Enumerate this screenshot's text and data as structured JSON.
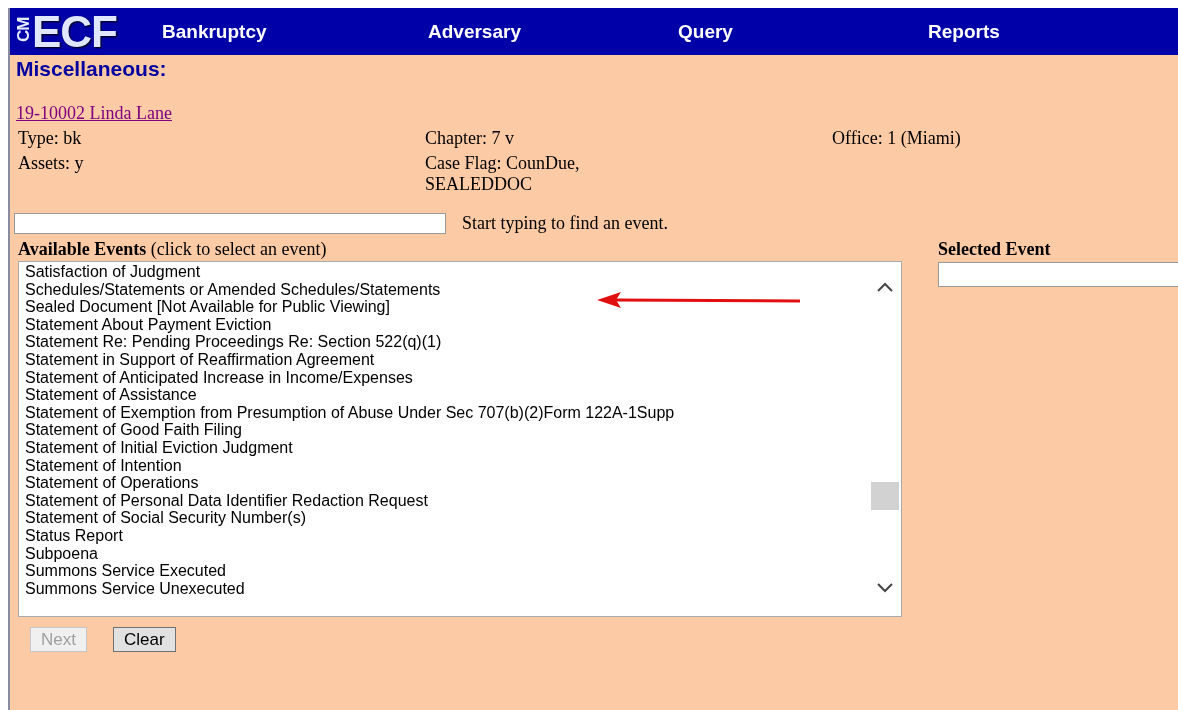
{
  "header": {
    "logo_small": "CM",
    "logo_large": "ECF",
    "nav": [
      "Bankruptcy",
      "Adversary",
      "Query",
      "Reports"
    ]
  },
  "page_title": "Miscellaneous:",
  "case_link": "19-10002 Linda Lane",
  "case_info": [
    [
      "Type: bk",
      "Chapter: 7 v",
      "Office: 1 (Miami)"
    ],
    [
      "Assets: y",
      "Case Flag: CounDue,\nSEALEDDOC"
    ]
  ],
  "search": {
    "hint": "Start typing to find an event."
  },
  "available": {
    "label": "Available Events",
    "note": "(click to select an event)",
    "items": [
      {
        "text": "Satisfaction of Judgment",
        "highlighted": false
      },
      {
        "text": "Schedules/Statements or Amended Schedules/Statements",
        "highlighted": false
      },
      {
        "text": "Sealed Document [Not Available for Public Viewing]",
        "highlighted": true
      },
      {
        "text": "Statement About Payment Eviction",
        "highlighted": false
      },
      {
        "text": "Statement Re: Pending Proceedings Re: Section 522(q)(1)",
        "highlighted": false
      },
      {
        "text": "Statement in Support of Reaffirmation Agreement",
        "highlighted": false
      },
      {
        "text": "Statement of Anticipated Increase in Income/Expenses",
        "highlighted": false
      },
      {
        "text": "Statement of Assistance",
        "highlighted": false
      },
      {
        "text": "Statement of Exemption from Presumption of Abuse Under Sec 707(b)(2)Form 122A-1Supp",
        "highlighted": false
      },
      {
        "text": "Statement of Good Faith Filing",
        "highlighted": false
      },
      {
        "text": "Statement of Initial Eviction Judgment",
        "highlighted": false
      },
      {
        "text": "Statement of Intention",
        "highlighted": false
      },
      {
        "text": "Statement of Operations",
        "highlighted": false
      },
      {
        "text": "Statement of Personal Data Identifier Redaction Request",
        "highlighted": false
      },
      {
        "text": "Statement of Social Security Number(s)",
        "highlighted": false
      },
      {
        "text": "Status Report",
        "highlighted": false
      },
      {
        "text": "Subpoena",
        "highlighted": false
      },
      {
        "text": "Summons Service Executed",
        "highlighted": false
      },
      {
        "text": "Summons Service Unexecuted",
        "highlighted": false
      }
    ]
  },
  "selected_event": {
    "label": "Selected Event"
  },
  "buttons": [
    {
      "label": "Next",
      "disabled": true
    },
    {
      "label": "Clear",
      "disabled": false
    }
  ]
}
